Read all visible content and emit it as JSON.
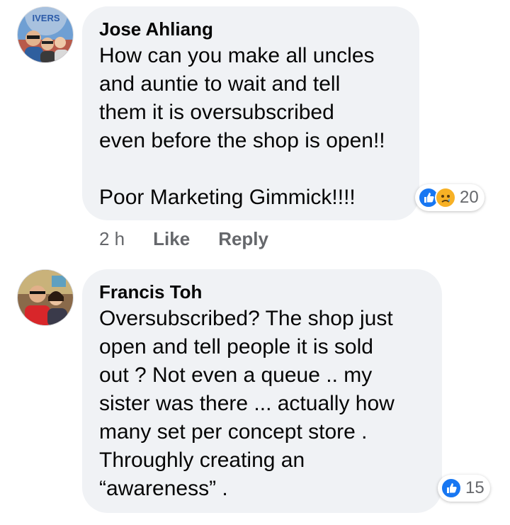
{
  "comments": [
    {
      "author": "Jose Ahliang",
      "text": "How can you make all uncles\nand auntie to wait and tell\nthem it is oversubscribed\neven before the shop is open!!\n\nPoor Marketing Gimmick!!!!",
      "reactions": {
        "icons": [
          "like-icon",
          "sad-icon"
        ],
        "count": "20"
      },
      "time": "2 h",
      "like_label": "Like",
      "reply_label": "Reply",
      "avatar_sign": "IVERS"
    },
    {
      "author": "Francis Toh",
      "text": "Oversubscribed? The shop just\nopen and tell people it is sold\nout ? Not even a queue .. my\nsister was there ... actually how\nmany set per concept store .\nThroughly creating an\n“awareness” .",
      "reactions": {
        "icons": [
          "like-icon"
        ],
        "count": "15"
      },
      "time": "",
      "like_label": "",
      "reply_label": ""
    }
  ],
  "colors": {
    "bubble": "#f0f2f5",
    "like_blue": "#1877f2",
    "sad_yellow": "#f7b125",
    "meta_gray": "#65676b"
  }
}
